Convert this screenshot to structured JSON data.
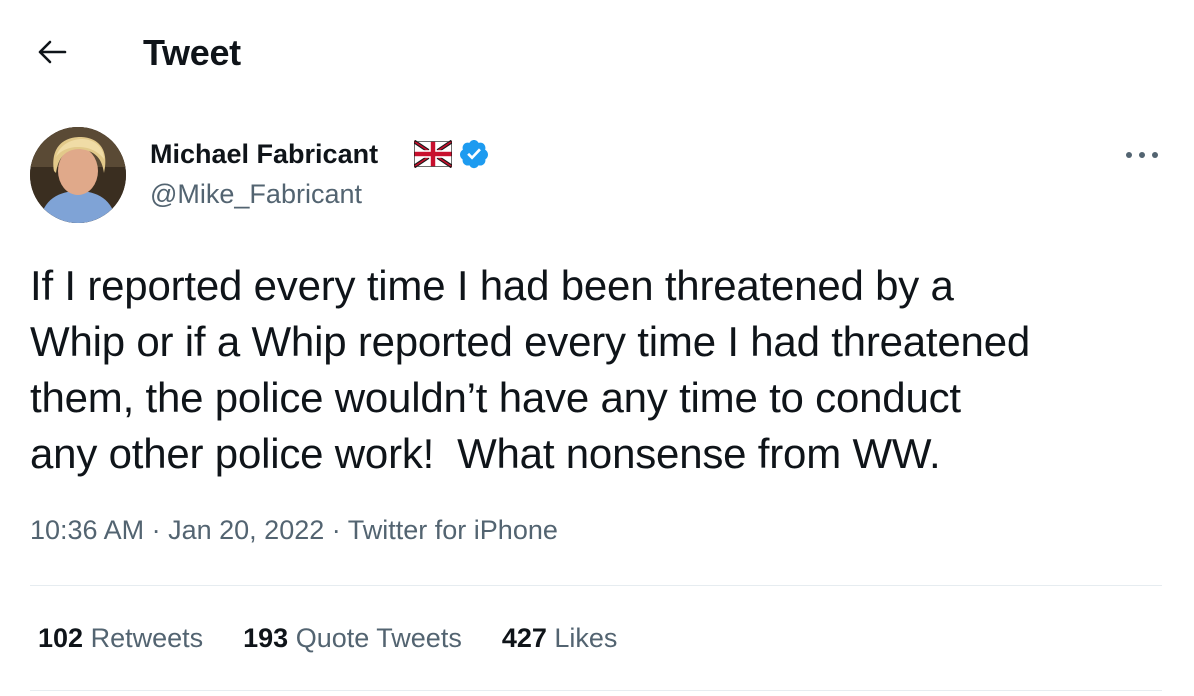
{
  "header": {
    "back_icon": "arrow-left-icon",
    "title": "Tweet"
  },
  "author": {
    "name": "Michael Fabricant",
    "handle": "@Mike_Fabricant",
    "badges": [
      "uk-flag-icon",
      "verified-icon"
    ],
    "verified_color": "#1d9bf0"
  },
  "tweet": {
    "text": "If I reported every time I had been threatened by a\nWhip or if a Whip reported every time I had threatened\nthem, the police wouldn’t have any time to conduct\nany other police work!  What nonsense from WW.",
    "time": "10:36 AM",
    "separator": "·",
    "date": "Jan 20, 2022",
    "source": "Twitter for iPhone"
  },
  "stats": {
    "retweets_count": "102",
    "retweets_label": "Retweets",
    "quotes_count": "193",
    "quotes_label": "Quote Tweets",
    "likes_count": "427",
    "likes_label": "Likes"
  },
  "more_icon": "more-horizontal-icon"
}
